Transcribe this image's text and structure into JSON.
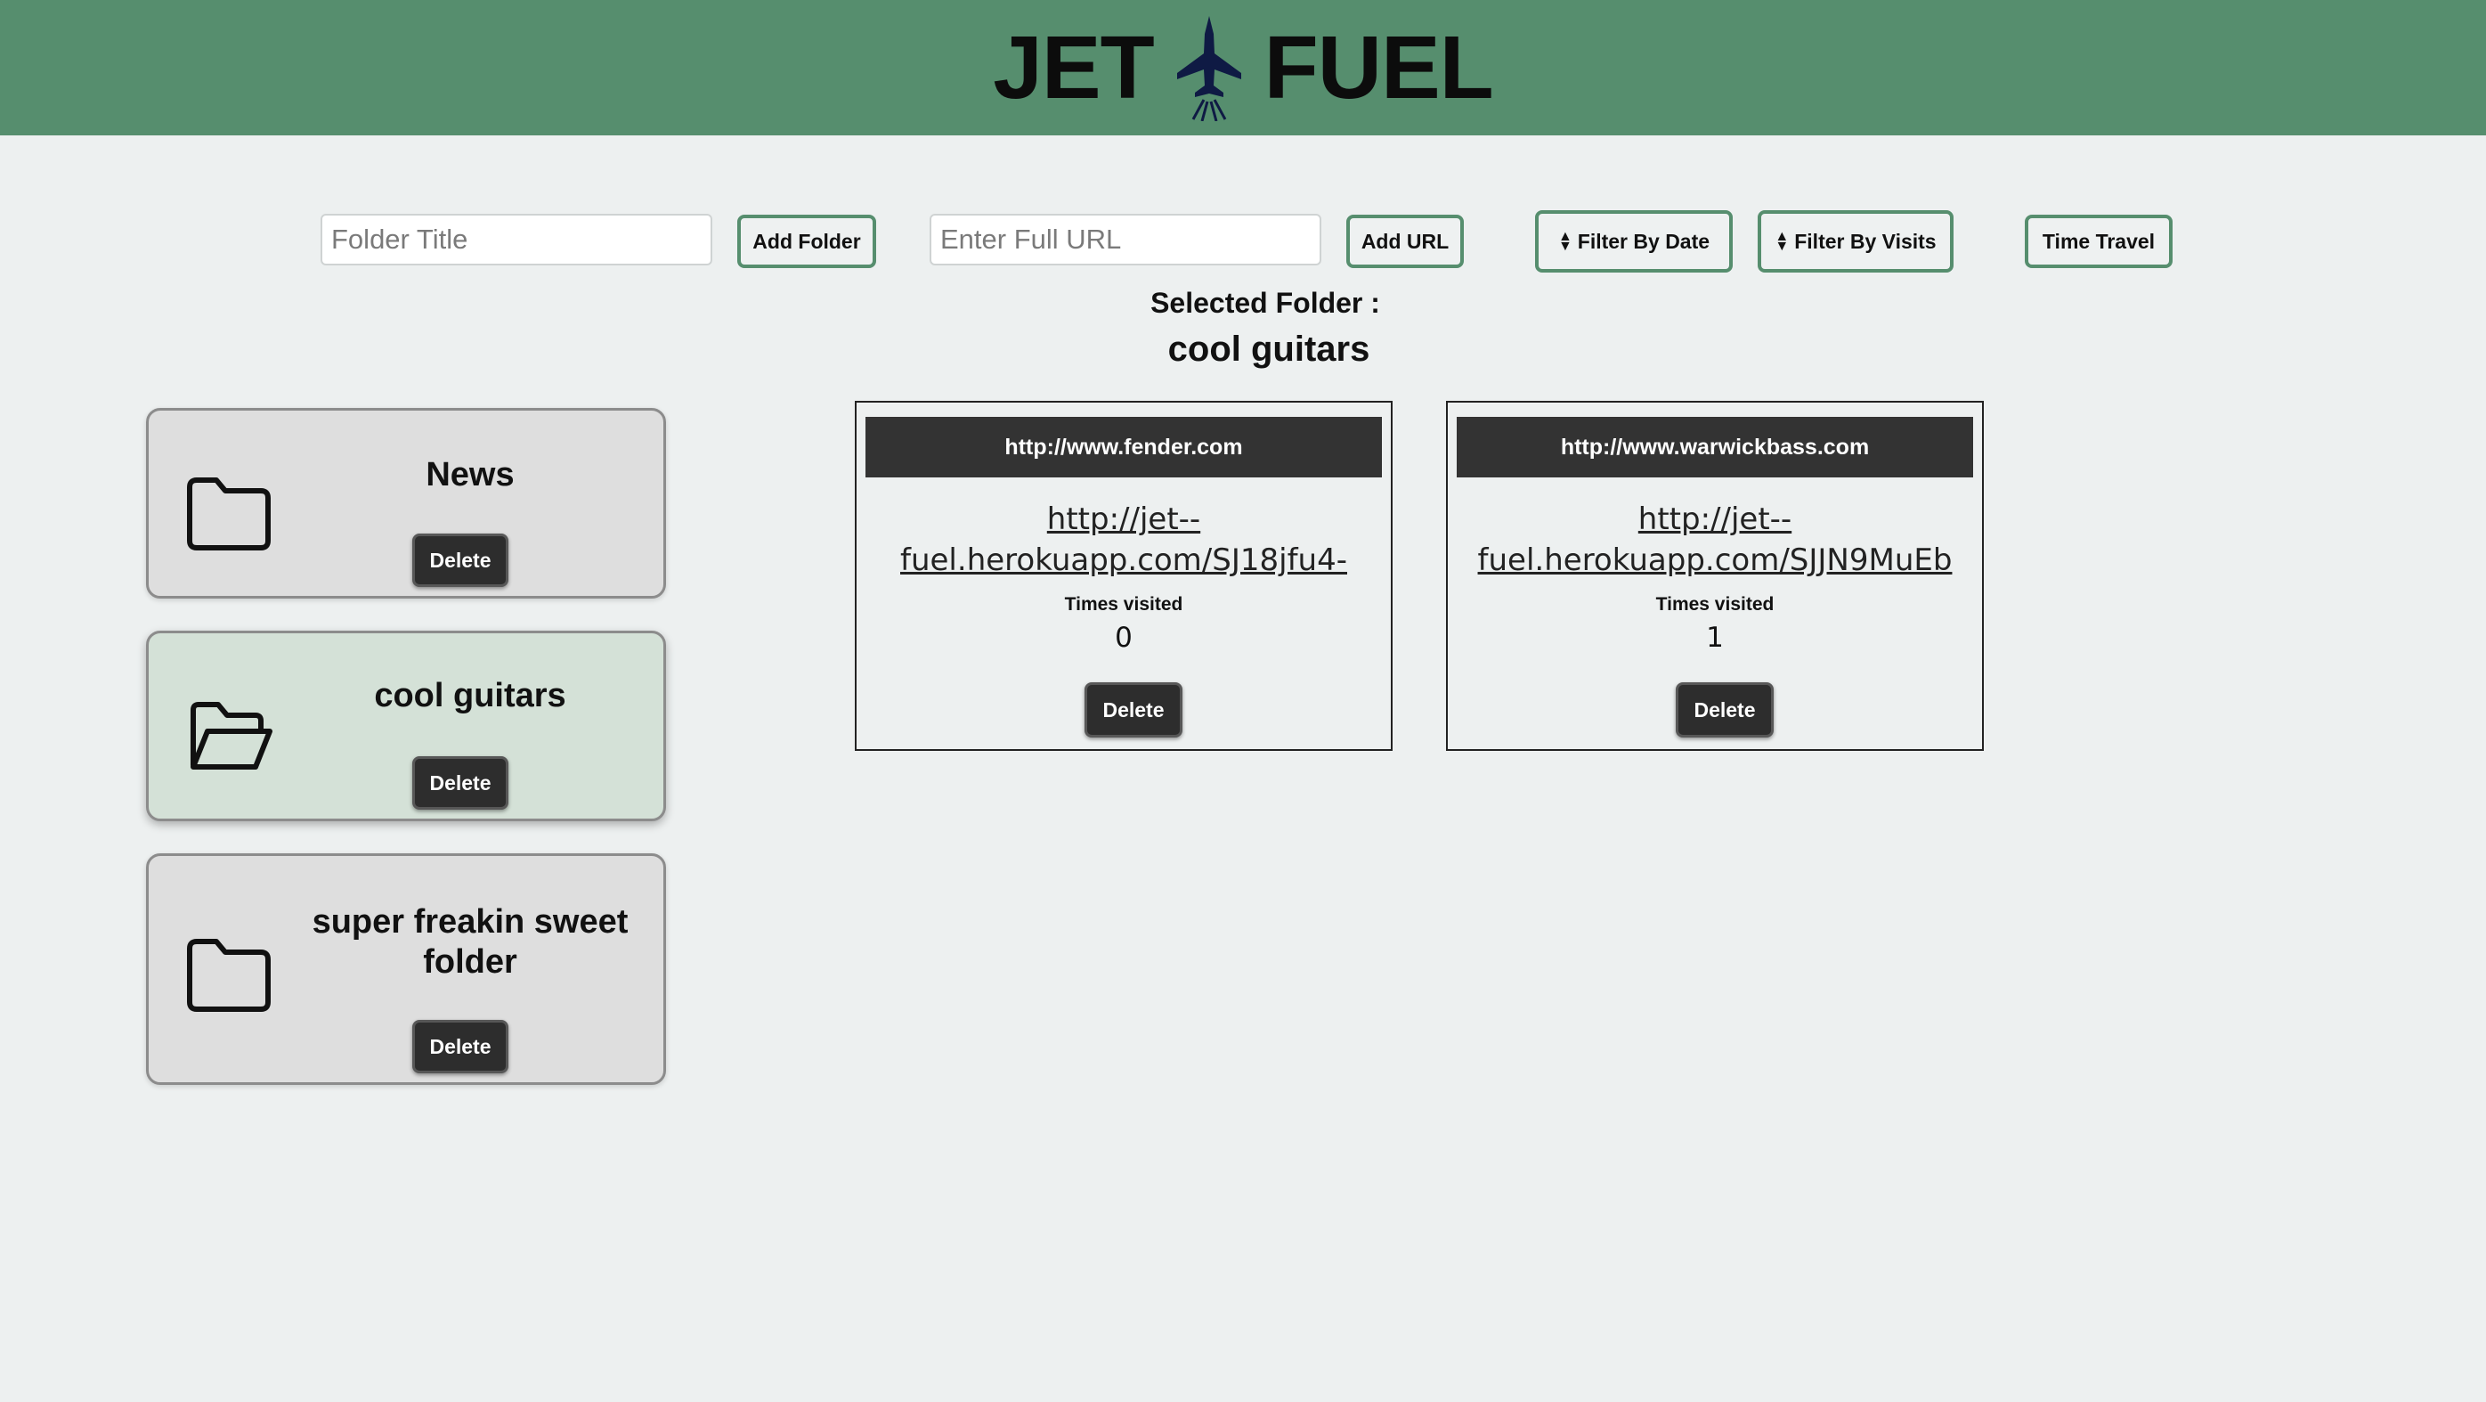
{
  "header": {
    "logo_left": "JET",
    "logo_right": "FUEL",
    "logo_icon": "jet-icon",
    "background": "#568e6e"
  },
  "controls": {
    "folder_title_placeholder": "Folder Title",
    "add_folder_label": "Add Folder",
    "url_placeholder": "Enter Full URL",
    "add_url_label": "Add URL",
    "filter_date_label": "Filter By Date",
    "filter_visits_label": "Filter By Visits",
    "time_travel_label": "Time Travel",
    "sort_icon": "sort-icon"
  },
  "selection": {
    "label": "Selected Folder :",
    "folder_name": "cool guitars"
  },
  "folders": [
    {
      "title": "News",
      "delete_label": "Delete",
      "icon": "folder-closed-icon",
      "selected": false
    },
    {
      "title": "cool guitars",
      "delete_label": "Delete",
      "icon": "folder-open-icon",
      "selected": true
    },
    {
      "title": "super freakin sweet folder",
      "delete_label": "Delete",
      "icon": "folder-closed-icon",
      "selected": false
    }
  ],
  "urls": [
    {
      "original": "http://www.fender.com",
      "short_line1": "http://jet--",
      "short_line2": "fuel.herokuapp.com/SJ18jfu4-",
      "visits_label": "Times visited",
      "visits": "0",
      "delete_label": "Delete"
    },
    {
      "original": "http://www.warwickbass.com",
      "short_line1": "http://jet--",
      "short_line2": "fuel.herokuapp.com/SJJN9MuEb",
      "visits_label": "Times visited",
      "visits": "1",
      "delete_label": "Delete"
    }
  ],
  "colors": {
    "accent": "#568e6e",
    "selected_folder_bg": "#d4e1d7",
    "folder_bg": "#dedede",
    "dark_button": "#2d2d2d",
    "page_bg": "#edf0f0"
  }
}
